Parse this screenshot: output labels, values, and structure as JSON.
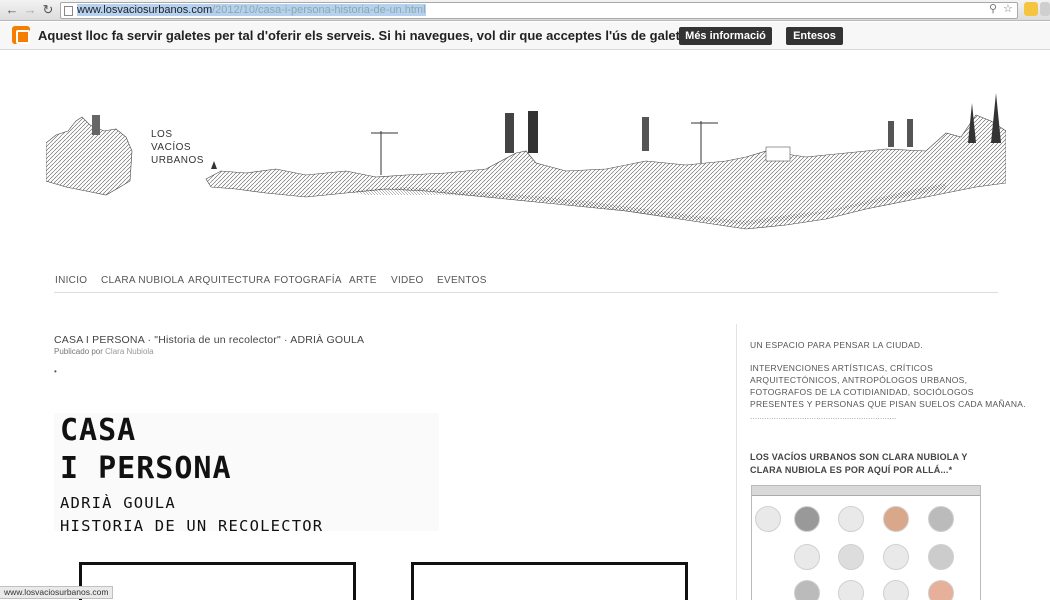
{
  "browser": {
    "url_host": "www.losvaciosurbanos.com",
    "url_path": "/2012/10/casa-i-persona-historia-de-un.html",
    "status_url": "www.losvaciosurbanos.com"
  },
  "cookie_bar": {
    "message": "Aquest lloc fa servir galetes per tal d'oferir els serveis. Si hi navegues, vol dir que acceptes l'ús de galetes.",
    "more_info": "Més informació",
    "accept": "Entesos"
  },
  "header": {
    "brand_line1": "LOS",
    "brand_line2": "VACÍOS",
    "brand_line3": "URBANOS"
  },
  "nav": {
    "items": [
      "INICIO",
      "CLARA NUBIOLA",
      "ARQUITECTURA",
      "FOTOGRAFÍA",
      "ARTE",
      "VIDEO",
      "EVENTOS"
    ]
  },
  "post": {
    "title": "CASA I PERSONA · \"Historia de un recolector\" · ADRIÀ GOULA",
    "byline_prefix": "Publicado por",
    "author": "Clara Nubiola",
    "bullet": "•",
    "poster_line1": "CASA",
    "poster_line2": "I PERSONA",
    "poster_line3": "ADRIÀ GOULA",
    "poster_line4": "HISTORIA DE UN RECOLECTOR"
  },
  "sidebar": {
    "tagline": "UN ESPACIO PARA PENSAR LA CIUDAD.",
    "desc_line1": "INTERVENCIONES ARTÍSTICAS, CRÍTICOS",
    "desc_line2": "ARQUITECTÓNICOS, ANTROPÓLOGOS URBANOS,",
    "desc_line3": "FOTOGRAFOS DE LA COTIDIANIDAD, SOCIÓLOGOS",
    "desc_line4": "PRESENTES Y PERSONAS QUE PISAN SUELOS CADA MAÑANA.",
    "dots": "..............................................................",
    "title_line1": "LOS VACÍOS URBANOS SON CLARA NUBIOLA Y",
    "title_line2": "CLARA NUBIOLA ES POR AQUÍ POR ALLÁ...*"
  }
}
